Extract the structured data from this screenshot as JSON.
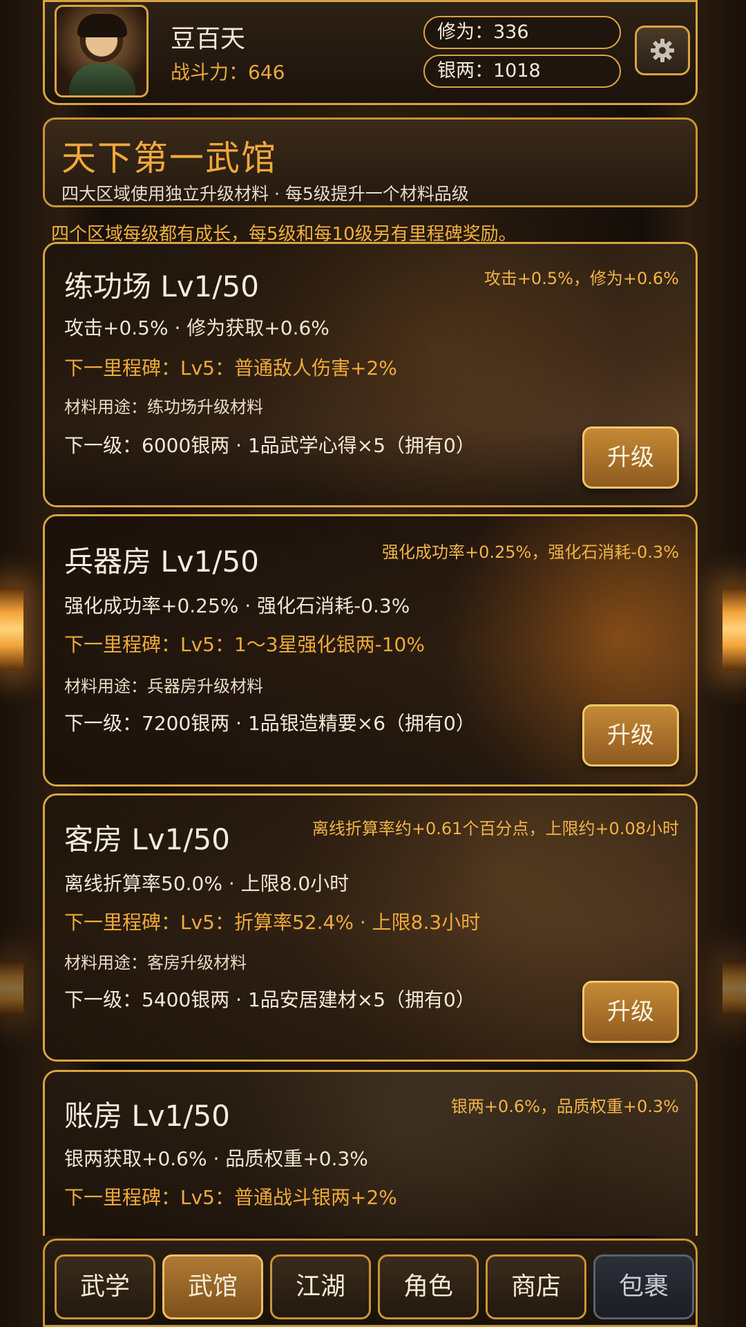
{
  "header": {
    "player_name": "豆百天",
    "power_text": "战斗力：646",
    "cultivation_text": "修为：336",
    "silver_text": "银两：1018",
    "settings_icon": "gear-icon"
  },
  "banner": {
    "title": "天下第一武馆",
    "subtitle": "四大区域使用独立升级材料 · 每5级提升一个材料品级"
  },
  "notice": "四个区域每级都有成长，每5级和每10级另有里程碑奖励。",
  "areas": [
    {
      "title": "练功场  Lv1/50",
      "bonus": "攻击+0.5%，修为+0.6%",
      "effect": "攻击+0.5% · 修为获取+0.6%",
      "milestone": "下一里程碑：Lv5：普通敌人伤害+2%",
      "material": "材料用途：练功场升级材料",
      "next": "下一级：6000银两 · 1品武学心得×5（拥有0）",
      "button": "升级"
    },
    {
      "title": "兵器房  Lv1/50",
      "bonus": "强化成功率+0.25%，强化石消耗-0.3%",
      "effect": "强化成功率+0.25% · 强化石消耗-0.3%",
      "milestone": "下一里程碑：Lv5：1～3星强化银两-10%",
      "material": "材料用途：兵器房升级材料",
      "next": "下一级：7200银两 · 1品银造精要×6（拥有0）",
      "button": "升级"
    },
    {
      "title": "客房  Lv1/50",
      "bonus": "离线折算率约+0.61个百分点，上限约+0.08小时",
      "effect": "离线折算率50.0% · 上限8.0小时",
      "milestone": "下一里程碑：Lv5：折算率52.4% · 上限8.3小时",
      "material": "材料用途：客房升级材料",
      "next": "下一级：5400银两 · 1品安居建材×5（拥有0）",
      "button": "升级"
    },
    {
      "title": "账房  Lv1/50",
      "bonus": "银两+0.6%，品质权重+0.3%",
      "effect": "银两获取+0.6% · 品质权重+0.3%",
      "milestone": "下一里程碑：Lv5：普通战斗银两+2%"
    }
  ],
  "nav": {
    "items": [
      "武学",
      "武馆",
      "江湖",
      "角色",
      "商店",
      "包裹"
    ],
    "active": "武馆"
  }
}
